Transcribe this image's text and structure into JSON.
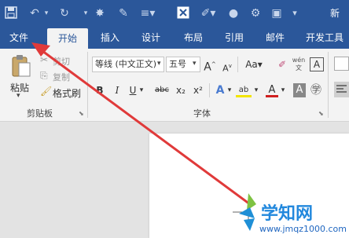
{
  "title_bar": {
    "title_fragment": "新",
    "icons": [
      "save-icon",
      "undo-icon",
      "redo-icon",
      "symbol-icon",
      "format-painter-icon",
      "list-icon",
      "close-box-icon",
      "pen-icon",
      "circle-icon",
      "window-icon"
    ]
  },
  "tabs": [
    {
      "label": "文件"
    },
    {
      "label": "开始"
    },
    {
      "label": "插入"
    },
    {
      "label": "设计"
    },
    {
      "label": "布局"
    },
    {
      "label": "引用"
    },
    {
      "label": "邮件"
    },
    {
      "label": "开发工具"
    }
  ],
  "clipboard": {
    "paste_label": "粘贴",
    "cut_label": "剪切",
    "copy_label": "复制",
    "format_painter_label": "格式刷",
    "group_label": "剪贴板"
  },
  "font": {
    "font_name": "等线 (中文正文)",
    "font_size": "五号",
    "grow_label": "A",
    "shrink_label": "A",
    "case_label": "Aa",
    "bold": "B",
    "italic": "I",
    "underline": "U",
    "strike": "abc",
    "subscript": "x₂",
    "superscript": "x²",
    "effects": "A",
    "highlight": "ab",
    "color": "A",
    "shade": "A",
    "wen": "wén",
    "group_label": "字体"
  },
  "watermark": {
    "brand": "学知网",
    "url": "www.jmqz1000.com"
  },
  "colors": {
    "accent": "#2b579a",
    "arrow": "#e03a3a",
    "highlight": "#f2e500",
    "font_color": "#d02020"
  }
}
